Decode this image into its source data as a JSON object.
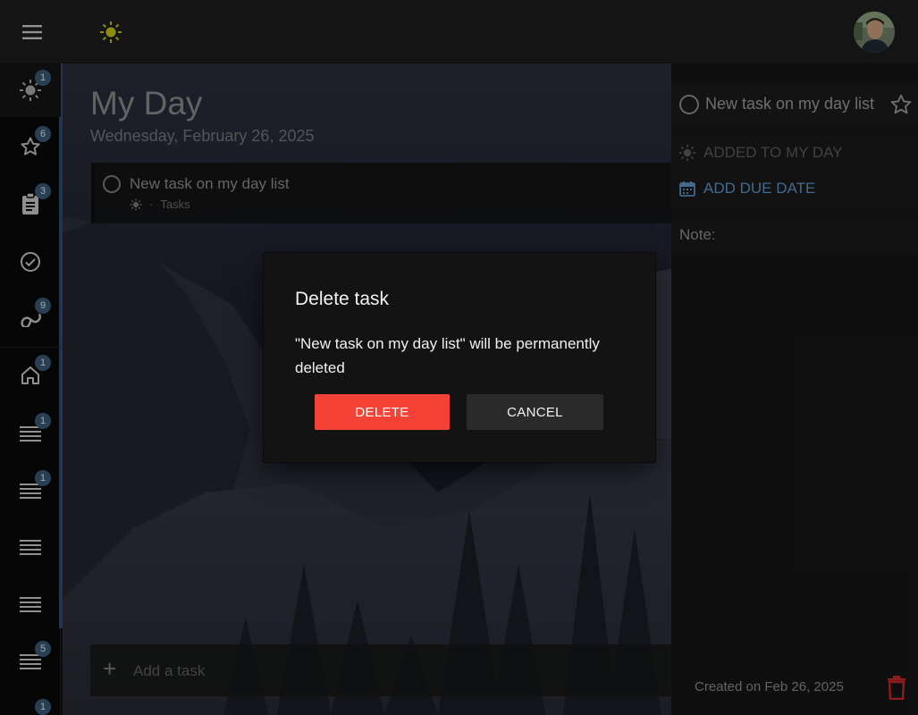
{
  "header": {
    "menu_icon": "hamburger-menu-icon",
    "theme_icon": "sun-icon",
    "avatar_icon": "user-avatar"
  },
  "sidebar": {
    "items": [
      {
        "icon": "sun-icon",
        "badge": "1"
      },
      {
        "icon": "star-icon",
        "badge": "6"
      },
      {
        "icon": "clipboard-icon",
        "badge": "3"
      },
      {
        "icon": "check-circle-icon",
        "badge": ""
      },
      {
        "icon": "infinity-icon",
        "badge": "9"
      },
      {
        "icon": "home-icon",
        "badge": "1"
      },
      {
        "icon": "list-icon",
        "badge": "1"
      },
      {
        "icon": "list-icon",
        "badge": "1"
      },
      {
        "icon": "list-icon",
        "badge": ""
      },
      {
        "icon": "list-icon",
        "badge": ""
      },
      {
        "icon": "list-icon",
        "badge": "5"
      },
      {
        "icon": "list-icon",
        "badge": "1"
      }
    ]
  },
  "main": {
    "title": "My Day",
    "date": "Wednesday, February 26, 2025",
    "task": {
      "title": "New task on my day list",
      "meta_separator": "·",
      "list_name": "Tasks"
    },
    "add_task_placeholder": "Add a task"
  },
  "detail": {
    "task_title": "New task on my day list",
    "added_to_my_day": "ADDED TO MY DAY",
    "add_due_date": "ADD DUE DATE",
    "note_label": "Note:",
    "created": "Created on Feb 26, 2025",
    "colors": {
      "due_date": "#5d93c4",
      "delete": "#d32f2f"
    }
  },
  "dialog": {
    "title": "Delete task",
    "body": "\"New task on my day list\" will be permanently deleted",
    "delete_label": "DELETE",
    "cancel_label": "CANCEL",
    "colors": {
      "delete": "#f44336"
    }
  }
}
